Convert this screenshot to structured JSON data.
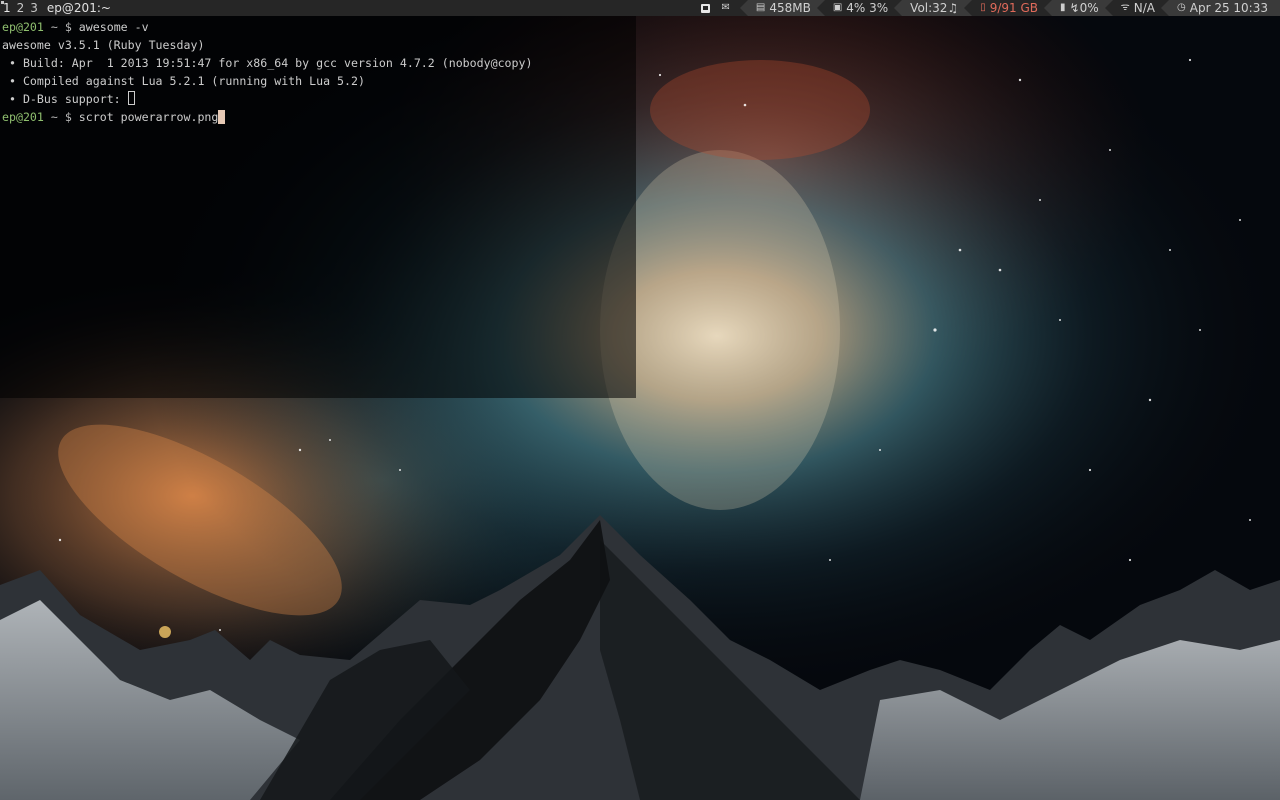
{
  "topbar": {
    "tags": [
      "1",
      "2",
      "3"
    ],
    "window_title": "ep@201:~",
    "layout_icon": "tile-layout-icon",
    "widgets": {
      "mail": {
        "icon": "mail-icon",
        "value": ""
      },
      "memory": {
        "icon": "memory-icon",
        "value": "458MB"
      },
      "cpu": {
        "icon": "cpu-icon",
        "value": "4% 3%"
      },
      "volume": {
        "label": "Vol:",
        "value": "32",
        "icon": "music-note-icon"
      },
      "disk": {
        "icon": "hdd-icon",
        "value": "9/91 GB"
      },
      "battery": {
        "icon": "battery-icon",
        "value": "↯0%"
      },
      "wifi": {
        "icon": "wifi-icon",
        "value": "N/A"
      },
      "clock": {
        "icon": "clock-icon",
        "value": "Apr 25 10:33"
      }
    },
    "colors": {
      "bg": "#262626",
      "bg_alt": "#3a3a3a",
      "disk_accent": "#e06a5a"
    }
  },
  "terminal": {
    "prompt_user": "ep@201",
    "prompt_path": " ~ $ ",
    "command_1": "awesome -v",
    "output": [
      "awesome v3.5.1 (Ruby Tuesday)",
      " • Build: Apr  1 2013 19:51:47 for x86_64 by gcc version 4.7.2 (nobody@copy)",
      " • Compiled against Lua 5.2.1 (running with Lua 5.2)",
      " • D-Bus support: "
    ],
    "command_2": "scrot powerarrow.png"
  }
}
